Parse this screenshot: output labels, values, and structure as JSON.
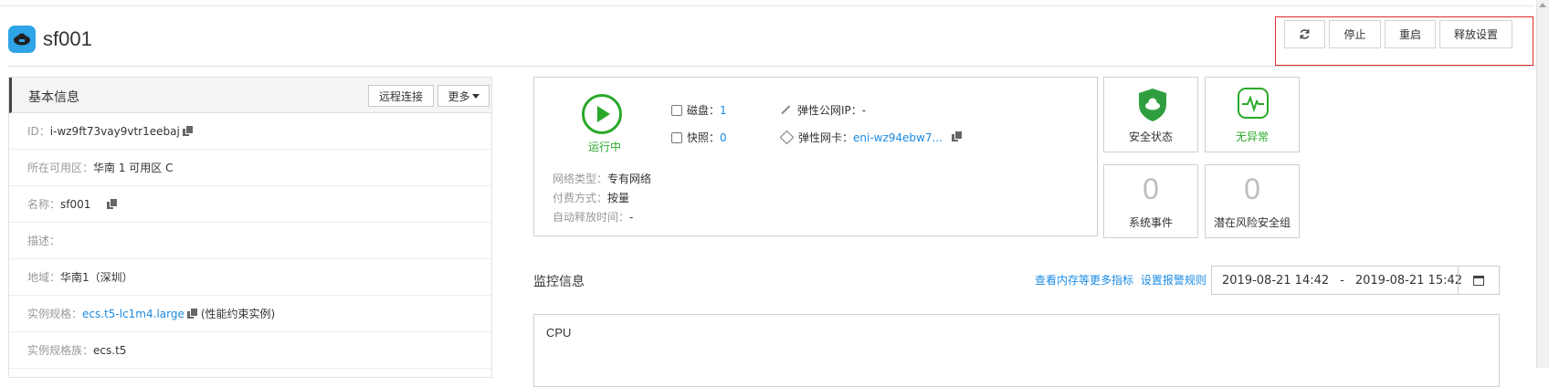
{
  "header": {
    "title": "sf001",
    "logo_icon": "cloud-icon",
    "brand_color": "#2fa4e7"
  },
  "actions": {
    "refresh_icon": "refresh-icon",
    "stop": "停止",
    "restart": "重启",
    "release": "释放设置"
  },
  "basic_info": {
    "title": "基本信息",
    "remote_btn": "远程连接",
    "more_btn": "更多",
    "rows": [
      {
        "label": "ID：",
        "value": "i-wz9ft73vay9vtr1eebaj"
      },
      {
        "label": "所在可用区：",
        "value": "华南 1 可用区 C"
      },
      {
        "label": "名称：",
        "value": "sf001"
      },
      {
        "label": "描述：",
        "value": ""
      },
      {
        "label": "地域：",
        "value": "华南1（深圳）"
      },
      {
        "label": "实例规格：",
        "value": "ecs.t5-lc1m4.large",
        "suffix": "(性能约束实例)"
      },
      {
        "label": "实例规格族：",
        "value": "ecs.t5"
      }
    ]
  },
  "status": {
    "state": "运行中",
    "state_color": "#2aa82a",
    "disk_label": "磁盘：",
    "disk_value": "1",
    "snapshot_label": "快照：",
    "snapshot_value": "0",
    "eip_label": "弹性公网IP：",
    "eip_value": "-",
    "eni_label": "弹性网卡：",
    "eni_value": "eni-wz94ebw7...",
    "network_type_label": "网络类型：",
    "network_type_value": "专有网络",
    "billing_label": "付费方式：",
    "billing_value": "按量",
    "auto_release_label": "自动释放时间：",
    "auto_release_value": "-"
  },
  "tiles": {
    "security_label": "安全状态",
    "security_icon": "shield-cloud-icon",
    "health_label": "无异常",
    "health_icon": "heartbeat-icon",
    "events_value": "0",
    "events_label": "系统事件",
    "risk_value": "0",
    "risk_label": "潜在风险安全组"
  },
  "monitor": {
    "title": "监控信息",
    "more_metrics_link": "查看内存等更多指标",
    "alert_rules_link": "设置报警规则",
    "start_time": "2019-08-21 14:42",
    "separator": "-",
    "end_time": "2019-08-21 15:42",
    "calendar_icon": "calendar-icon",
    "cpu_label": "CPU"
  }
}
